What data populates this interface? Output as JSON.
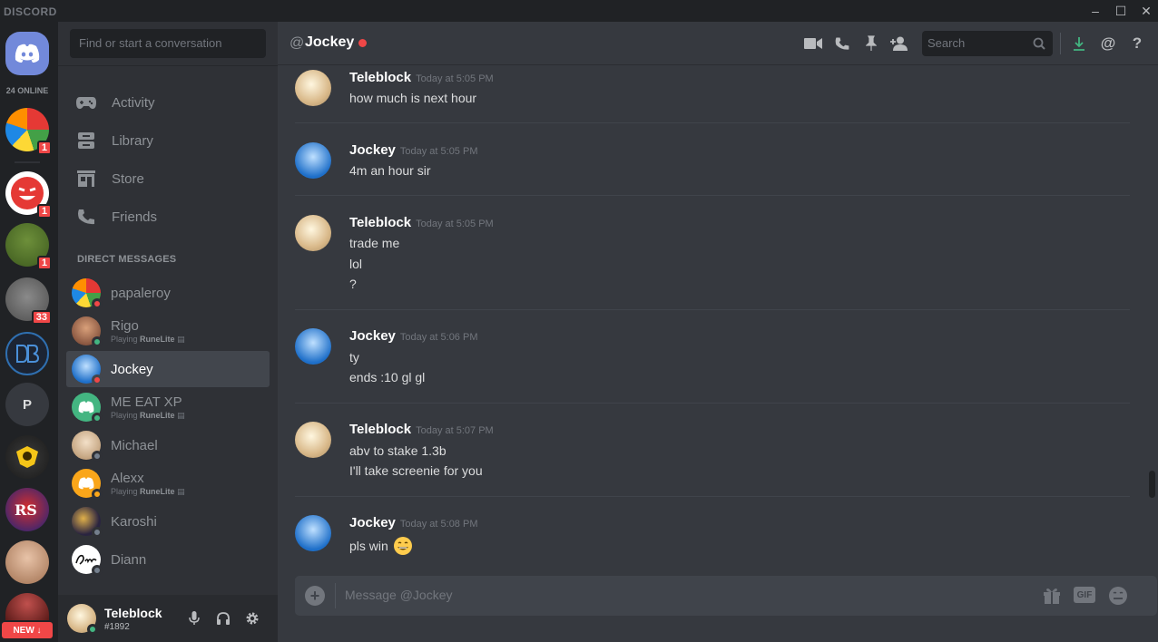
{
  "app": {
    "brand": "DISCORD"
  },
  "window": {
    "minimize": "–",
    "maximize": "☐",
    "close": "✕"
  },
  "guilds": {
    "online_label": "24 ONLINE",
    "badges": [
      "1",
      "1",
      "1",
      "33"
    ],
    "dm_initial": "P",
    "new_label": "NEW ↓"
  },
  "sidebar": {
    "search_placeholder": "Find or start a conversation",
    "nav": [
      "Activity",
      "Library",
      "Store",
      "Friends"
    ],
    "dm_header": "DIRECT MESSAGES",
    "dms": [
      {
        "name": "papaleroy",
        "playing": "",
        "status": "dnd"
      },
      {
        "name": "Rigo",
        "playing": "RuneLite",
        "status": "online"
      },
      {
        "name": "Jockey",
        "playing": "",
        "status": "dnd",
        "active": true
      },
      {
        "name": "ME EAT XP",
        "playing": "RuneLite",
        "status": "online"
      },
      {
        "name": "Michael",
        "playing": "",
        "status": "offline"
      },
      {
        "name": "Alexx",
        "playing": "RuneLite",
        "status": "idle"
      },
      {
        "name": "Karoshi",
        "playing": "",
        "status": "offline"
      },
      {
        "name": "Diann",
        "playing": "",
        "status": "offline"
      }
    ],
    "playing_prefix": "Playing",
    "user": {
      "name": "Teleblock",
      "tag": "#1892"
    }
  },
  "chat": {
    "at": "@",
    "title": "Jockey",
    "search_placeholder": "Search",
    "messages": [
      {
        "author": "Teleblock",
        "time": "Today at 5:05 PM",
        "lines": [
          "how much is next hour"
        ]
      },
      {
        "author": "Jockey",
        "time": "Today at 5:05 PM",
        "lines": [
          "4m an hour sir"
        ]
      },
      {
        "author": "Teleblock",
        "time": "Today at 5:05 PM",
        "lines": [
          "trade me",
          "lol",
          "?"
        ]
      },
      {
        "author": "Jockey",
        "time": "Today at 5:06 PM",
        "lines": [
          "ty",
          "ends :10 gl gl"
        ]
      },
      {
        "author": "Teleblock",
        "time": "Today at 5:07 PM",
        "lines": [
          "abv to stake 1.3b",
          "I'll take screenie for you"
        ]
      },
      {
        "author": "Jockey",
        "time": "Today at 5:08 PM",
        "lines": [
          "pls win"
        ]
      }
    ],
    "composer_placeholder": "Message @Jockey",
    "gif_label": "GIF"
  },
  "colors": {
    "dnd": "#f04747",
    "online": "#43b581",
    "idle": "#faa61a",
    "offline": "#747f8d",
    "brand": "#7289da"
  }
}
